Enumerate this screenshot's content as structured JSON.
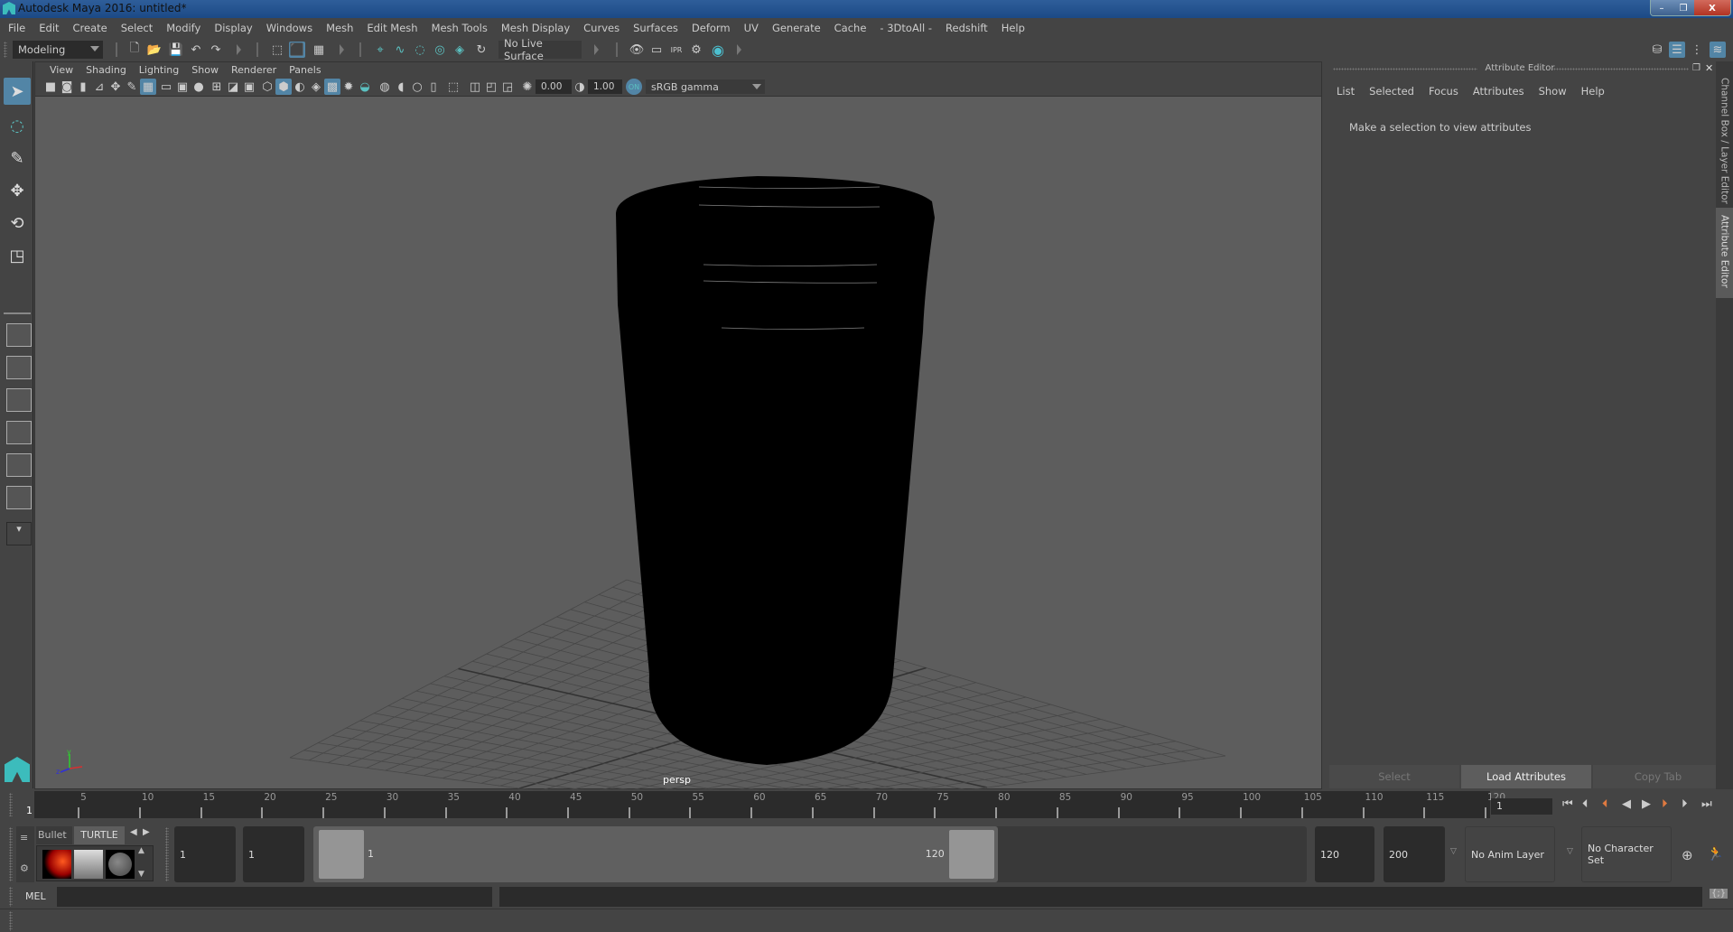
{
  "window": {
    "title": "Autodesk Maya 2016: untitled*",
    "controls": {
      "minimize": "–",
      "restore": "❐",
      "close": "X"
    }
  },
  "menubar": {
    "items": [
      "File",
      "Edit",
      "Create",
      "Select",
      "Modify",
      "Display",
      "Windows",
      "Mesh",
      "Edit Mesh",
      "Mesh Tools",
      "Mesh Display",
      "Curves",
      "Surfaces",
      "Deform",
      "UV",
      "Generate",
      "Cache",
      "- 3DtoAll -",
      "Redshift",
      "Help"
    ]
  },
  "statusline": {
    "menuset": "Modeling",
    "live_surface": "No Live Surface",
    "icons": [
      "new-scene",
      "open-scene",
      "save-scene",
      "undo",
      "redo",
      "select-by-hierarchy",
      "select-by-object",
      "select-by-component",
      "snap-grid",
      "snap-curve",
      "snap-point",
      "snap-view-plane",
      "snap-live",
      "snap-projected-center",
      "render-view",
      "render-frame",
      "ipr-render",
      "render-settings",
      "hypershade"
    ]
  },
  "viewport": {
    "menu": [
      "View",
      "Shading",
      "Lighting",
      "Show",
      "Renderer",
      "Panels"
    ],
    "exposure": "0.00",
    "gamma": "1.00",
    "color_space": "sRGB gamma",
    "camera_label": "persp",
    "axis": {
      "x": "x",
      "y": "y",
      "z": "z"
    }
  },
  "toolbox": {
    "tools": [
      "select-tool",
      "lasso-tool",
      "paint-select-tool",
      "move-tool",
      "rotate-tool",
      "scale-tool"
    ],
    "layouts": [
      "single-perspective-view",
      "four-view",
      "persp-outliner",
      "persp-graph",
      "hypershade-persp",
      "persp-graph-hypergraph",
      "more-layouts"
    ]
  },
  "attribute_editor": {
    "title": "Attribute Editor",
    "menu": [
      "List",
      "Selected",
      "Focus",
      "Attributes",
      "Show",
      "Help"
    ],
    "message": "Make a selection to view attributes",
    "buttons": {
      "select": "Select",
      "load": "Load Attributes",
      "copy": "Copy Tab"
    }
  },
  "side_tabs": {
    "channel_box": "Channel Box / Layer Editor",
    "attribute_editor": "Attribute Editor"
  },
  "time_slider": {
    "current_frame": "1",
    "ticks": [
      "5",
      "10",
      "15",
      "20",
      "25",
      "30",
      "35",
      "40",
      "45",
      "50",
      "55",
      "60",
      "65",
      "70",
      "75",
      "80",
      "85",
      "90",
      "95",
      "100",
      "105",
      "110",
      "115",
      "120"
    ],
    "current_time_field": "1"
  },
  "playback": [
    "go-to-start",
    "step-back-frame",
    "step-back-key",
    "play-backwards",
    "play-forwards",
    "step-forward-key",
    "step-forward-frame",
    "go-to-end"
  ],
  "range_slider": {
    "start_time": "1",
    "playback_start": "1",
    "range_start_label": "1",
    "range_end_label": "120",
    "playback_end": "120",
    "end_time": "200",
    "anim_layer": "No Anim Layer",
    "character_set": "No Character Set"
  },
  "shelf": {
    "tabs": [
      "Bullet",
      "TURTLE"
    ],
    "active_tab": "TURTLE",
    "items": [
      "turtle-bake",
      "turtle-render-settings",
      "turtle-surface-shader"
    ]
  },
  "command_line": {
    "label": "MEL",
    "value": ""
  }
}
